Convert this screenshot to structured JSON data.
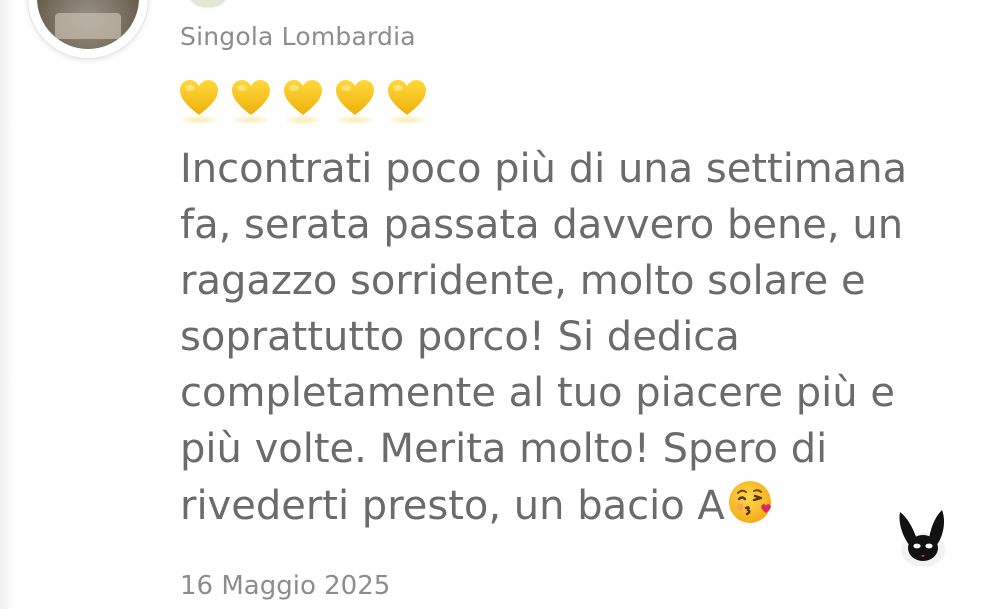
{
  "review": {
    "author": "Singola Lombardia",
    "rating": 5,
    "rating_max": 5,
    "rating_icon": "yellow-heart-icon",
    "text_lines": [
      "Incontrati poco più di una settimana",
      "fa, serata passata davvero bene, un",
      "ragazzo sorridente, molto solare e",
      "soprattutto porco! Si dedica",
      "completamente al tuo piacere più e",
      "più volte. Merita molto! Spero di",
      "rivederti presto, un bacio A"
    ],
    "ending_emoji": "kissing-face-emoji",
    "date": "16 Maggio 2025"
  },
  "colors": {
    "heart": "#f7c51e",
    "text": "#6b6b6b",
    "meta_text": "#8d8d8d"
  },
  "brand_icon": "bunny-logo-icon"
}
